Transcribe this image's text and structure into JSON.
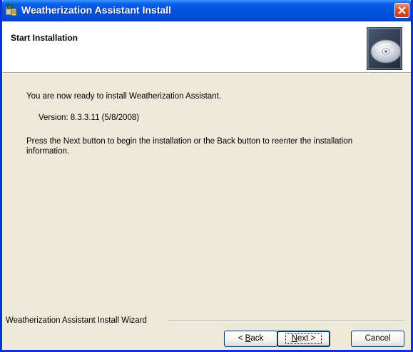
{
  "window": {
    "title": "Weatherization Assistant Install",
    "title_color": "#ffffff",
    "titlebar_color": "#0054e3",
    "close_button_color": "#d9542b"
  },
  "header": {
    "title": "Start Installation",
    "icon": "cd-disc-icon"
  },
  "body": {
    "ready_text": "You are now ready to install Weatherization Assistant.",
    "version_text": "Version: 8.3.3.11 (5/8/2008)",
    "instruction_text": "Press the Next button to begin the installation or the Back button to reenter the installation information."
  },
  "footer": {
    "group_label": "Weatherization Assistant Install Wizard",
    "back_prefix": "< ",
    "back_hotkey": "B",
    "back_rest": "ack",
    "next_hotkey": "N",
    "next_rest": "ext >",
    "cancel_label": "Cancel"
  }
}
